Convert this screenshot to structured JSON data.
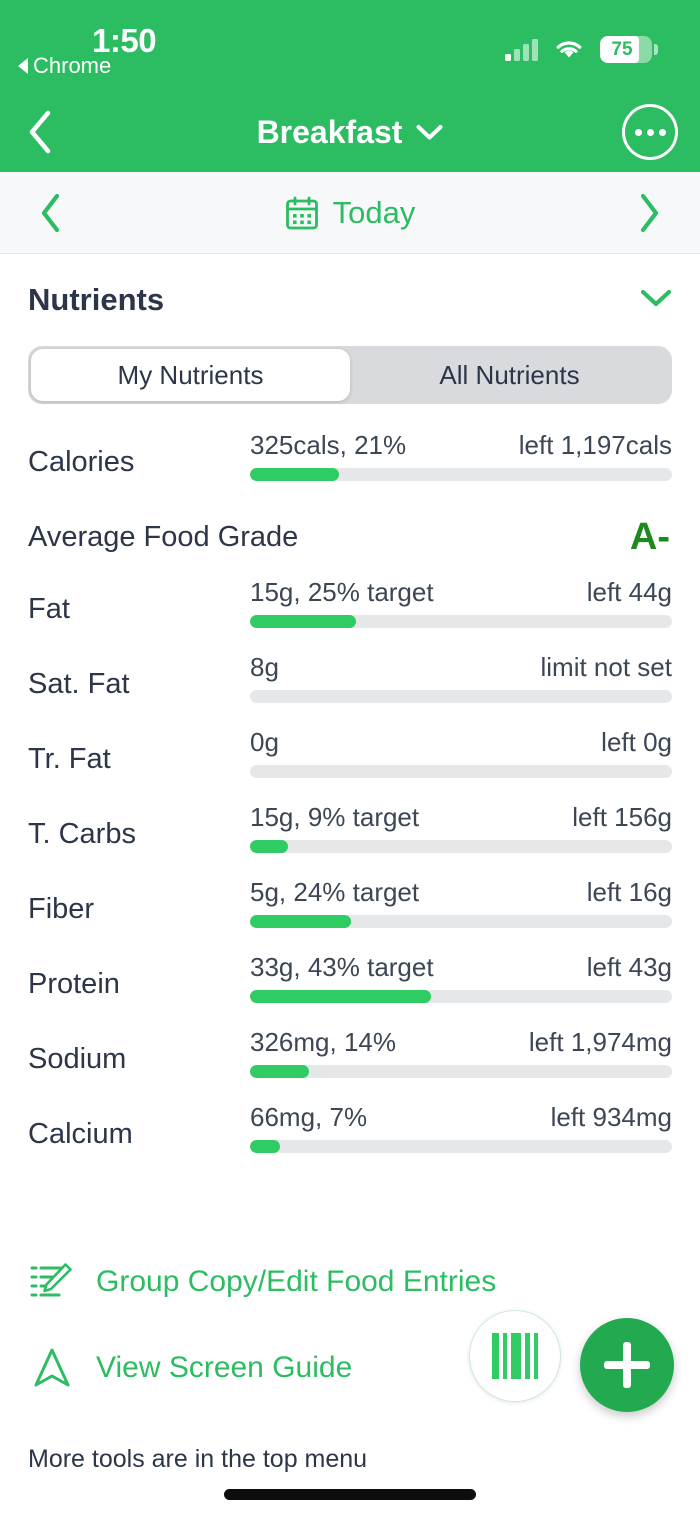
{
  "statusbar": {
    "time": "1:50",
    "back_app": "Chrome",
    "battery_level": "75",
    "battery_percent": 75,
    "wifi_icon": "wifi-icon",
    "signal_icon": "cellular-signal-icon"
  },
  "navbar": {
    "title": "Breakfast",
    "back_icon": "chevron-left-icon",
    "dropdown_icon": "chevron-down-icon",
    "more_icon": "more-options-icon"
  },
  "datebar": {
    "prev_icon": "chevron-left-icon",
    "next_icon": "chevron-right-icon",
    "calendar_icon": "calendar-icon",
    "label": "Today"
  },
  "section": {
    "title": "Nutrients",
    "collapse_icon": "chevron-down-icon"
  },
  "segmented": {
    "options": [
      {
        "label": "My Nutrients",
        "selected": true
      },
      {
        "label": "All Nutrients",
        "selected": false
      }
    ]
  },
  "grade": {
    "label": "Average Food Grade",
    "value": "A-",
    "color": "#1e8a1e"
  },
  "nutrients": [
    {
      "name": "Calories",
      "amount": "325cals, 21%",
      "remaining": "left 1,197cals",
      "percent": 21
    },
    {
      "name": "Fat",
      "amount": "15g, 25% target",
      "remaining": "left 44g",
      "percent": 25
    },
    {
      "name": "Sat. Fat",
      "amount": "8g",
      "remaining": "limit not set",
      "percent": 0
    },
    {
      "name": "Tr. Fat",
      "amount": "0g",
      "remaining": "left 0g",
      "percent": 0
    },
    {
      "name": "T. Carbs",
      "amount": "15g, 9% target",
      "remaining": "left 156g",
      "percent": 9
    },
    {
      "name": "Fiber",
      "amount": "5g, 24% target",
      "remaining": "left 16g",
      "percent": 24
    },
    {
      "name": "Protein",
      "amount": "33g, 43% target",
      "remaining": "left 43g",
      "percent": 43
    },
    {
      "name": "Sodium",
      "amount": "326mg, 14%",
      "remaining": "left 1,974mg",
      "percent": 14
    },
    {
      "name": "Calcium",
      "amount": "66mg, 7%",
      "remaining": "left 934mg",
      "percent": 7
    }
  ],
  "tools": [
    {
      "label": "Group Copy/Edit Food Entries",
      "icon": "edit-list-icon"
    },
    {
      "label": "View Screen Guide",
      "icon": "navigation-arrow-icon"
    }
  ],
  "footnote": "More tools are in the top menu",
  "fabs": {
    "barcode_icon": "barcode-scan-icon",
    "add_icon": "plus-icon"
  },
  "colors": {
    "brand_green": "#2cbc62",
    "progress_green": "#2ecc62",
    "fab_green": "#23a94f",
    "grade_green": "#1e8a1e",
    "text_dark": "#2c3648",
    "track_gray": "#e6e7e9"
  }
}
